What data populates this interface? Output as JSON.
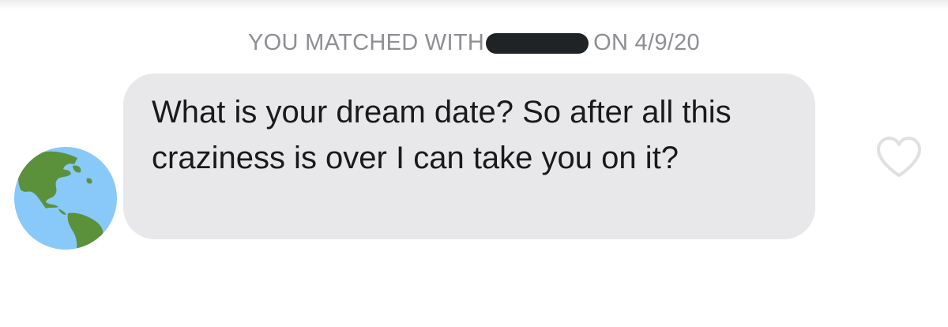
{
  "match_banner": {
    "prefix": "YOU MATCHED WITH",
    "suffix": "ON 4/9/20"
  },
  "avatar": {
    "icon": "globe-americas-icon"
  },
  "message": {
    "text": "What is your dream date? So after all this craziness is over I can take you on it?"
  },
  "actions": {
    "like_icon": "heart-outline-icon"
  },
  "colors": {
    "bubble": "#e8e8ea",
    "banner_text": "#8e8e93",
    "globe_ocean": "#88c9f9",
    "globe_land": "#5c913b"
  }
}
